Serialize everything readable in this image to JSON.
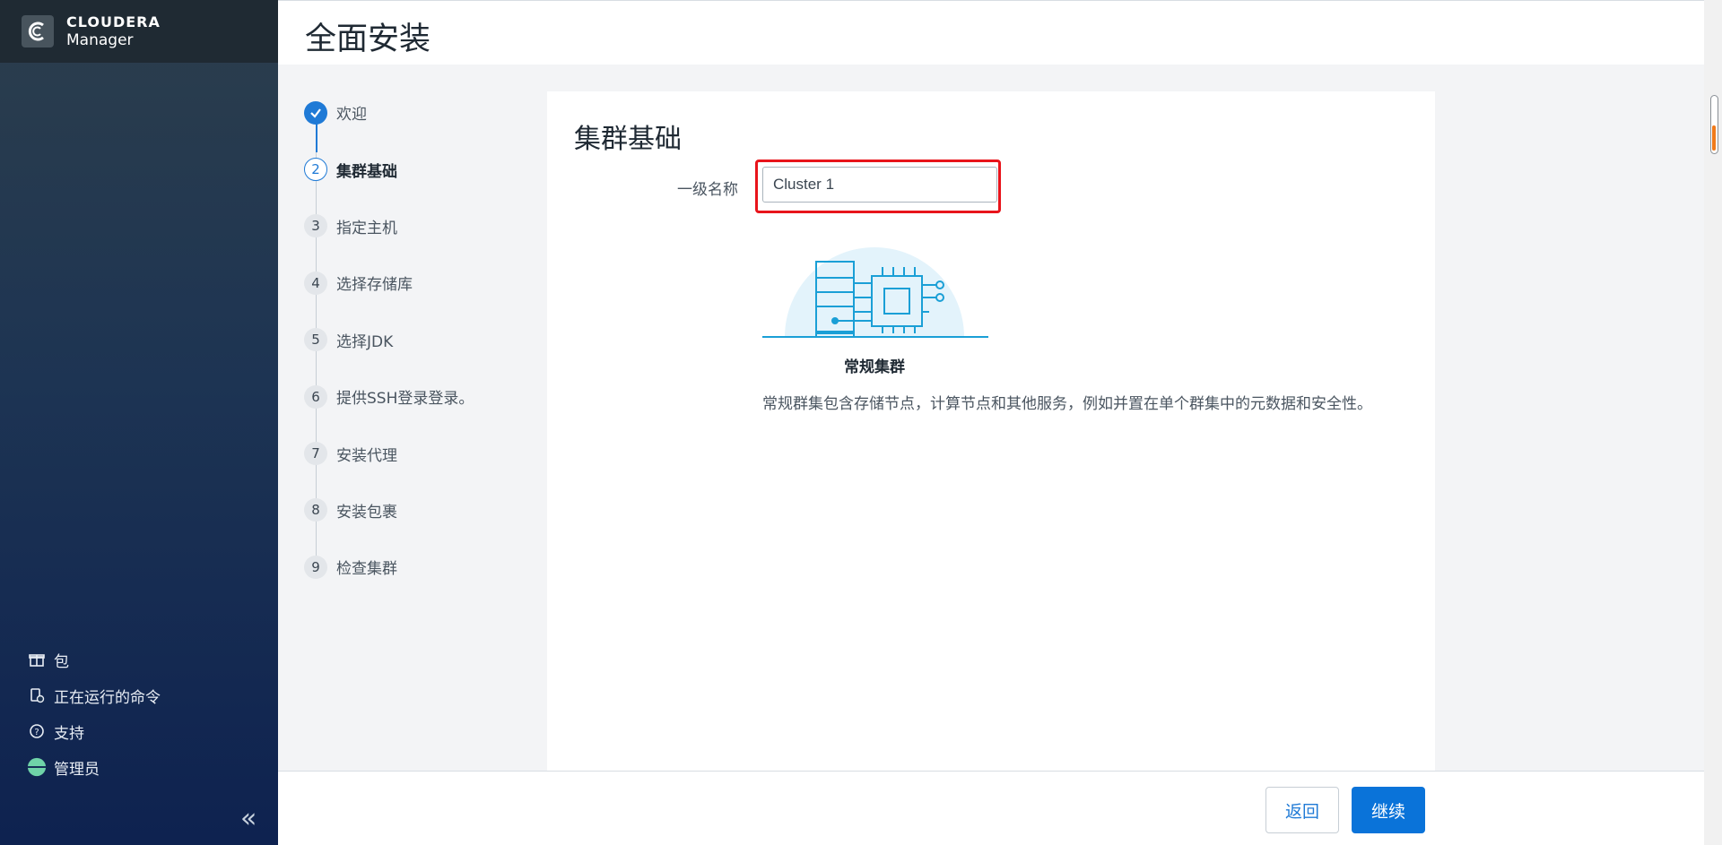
{
  "brand": {
    "name": "CLOUDERA",
    "sub": "Manager"
  },
  "sidebar": {
    "items": [
      {
        "label": "包",
        "icon": "package-icon"
      },
      {
        "label": "正在运行的命令",
        "icon": "running-commands-icon"
      },
      {
        "label": "支持",
        "icon": "help-icon"
      },
      {
        "label": "管理员",
        "icon": "user-avatar-icon"
      }
    ],
    "collapse": "«"
  },
  "header": {
    "title": "全面安装"
  },
  "steps": [
    {
      "num": "1",
      "label": "欢迎",
      "state": "done"
    },
    {
      "num": "2",
      "label": "集群基础",
      "state": "active"
    },
    {
      "num": "3",
      "label": "指定主机",
      "state": "pending"
    },
    {
      "num": "4",
      "label": "选择存储库",
      "state": "pending"
    },
    {
      "num": "5",
      "label": "选择JDK",
      "state": "pending"
    },
    {
      "num": "6",
      "label": "提供SSH登录登录。",
      "state": "pending"
    },
    {
      "num": "7",
      "label": "安装代理",
      "state": "pending"
    },
    {
      "num": "8",
      "label": "安装包裹",
      "state": "pending"
    },
    {
      "num": "9",
      "label": "检查集群",
      "state": "pending"
    }
  ],
  "main": {
    "title": "集群基础",
    "name_label": "一级名称",
    "name_value": "Cluster 1",
    "cluster_type": "常规集群",
    "cluster_desc": "常规群集包含存储节点，计算节点和其他服务，例如并置在单个群集中的元数据和安全性。"
  },
  "footer": {
    "back_label": "返回",
    "next_label": "继续"
  },
  "colors": {
    "accent": "#0a73d9",
    "highlight": "#e8141b",
    "sidebar_bottom": "#0e2250"
  }
}
